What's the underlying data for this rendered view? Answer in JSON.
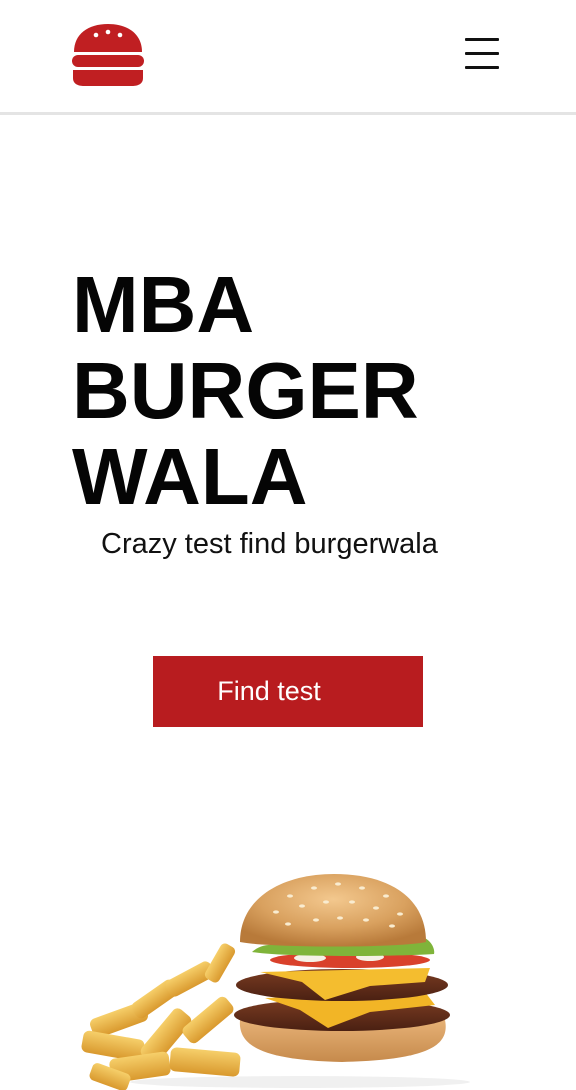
{
  "header": {
    "logo_icon": "burger-logo-icon",
    "menu_icon": "hamburger-menu-icon"
  },
  "hero": {
    "title_lines": [
      "MBA",
      "BURGER",
      "WALA"
    ],
    "subtitle": "Crazy test find burgerwala",
    "cta_label": "Find test"
  },
  "image": {
    "subject": "burger-and-fries-image"
  },
  "colors": {
    "brand_red": "#b81c1f",
    "text": "#050505",
    "background": "#ffffff",
    "header_border": "#e4e4e4"
  }
}
